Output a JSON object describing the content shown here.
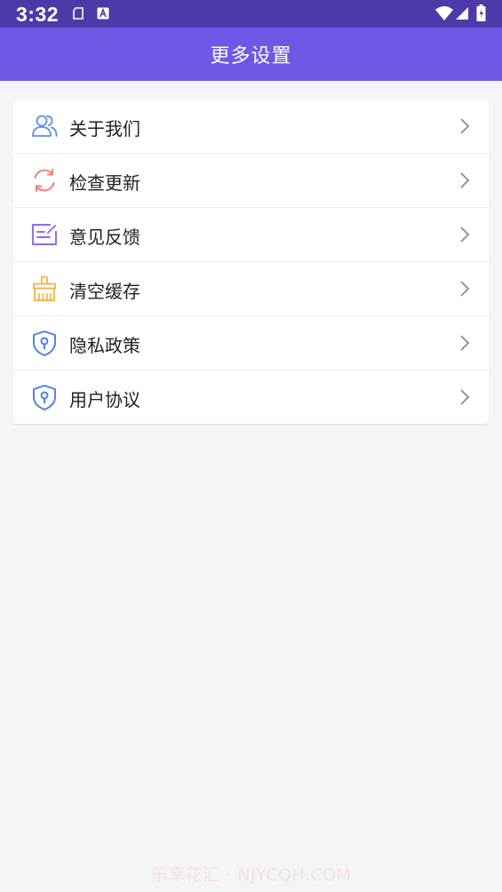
{
  "status_bar": {
    "time": "3:32",
    "icons": [
      "sim-icon",
      "notification-a-icon",
      "wifi-icon",
      "signal-icon",
      "battery-icon"
    ]
  },
  "app_bar": {
    "title": "更多设置"
  },
  "menu": {
    "items": [
      {
        "label": "关于我们",
        "icon": "users-icon",
        "color": "#5b8def"
      },
      {
        "label": "检查更新",
        "icon": "refresh-icon",
        "color": "#f27b7b"
      },
      {
        "label": "意见反馈",
        "icon": "feedback-icon",
        "color": "#8a6ce8"
      },
      {
        "label": "清空缓存",
        "icon": "broom-icon",
        "color": "#f5b041"
      },
      {
        "label": "隐私政策",
        "icon": "shield-key-icon",
        "color": "#4e7ce8"
      },
      {
        "label": "用户协议",
        "icon": "shield-key-icon",
        "color": "#4e7ce8"
      }
    ]
  },
  "watermark": "乐享花汇 · NJYCQH.COM",
  "colors": {
    "status_bar": "#4d3aa8",
    "app_bar": "#6e58e6",
    "background": "#f4f5f8"
  }
}
